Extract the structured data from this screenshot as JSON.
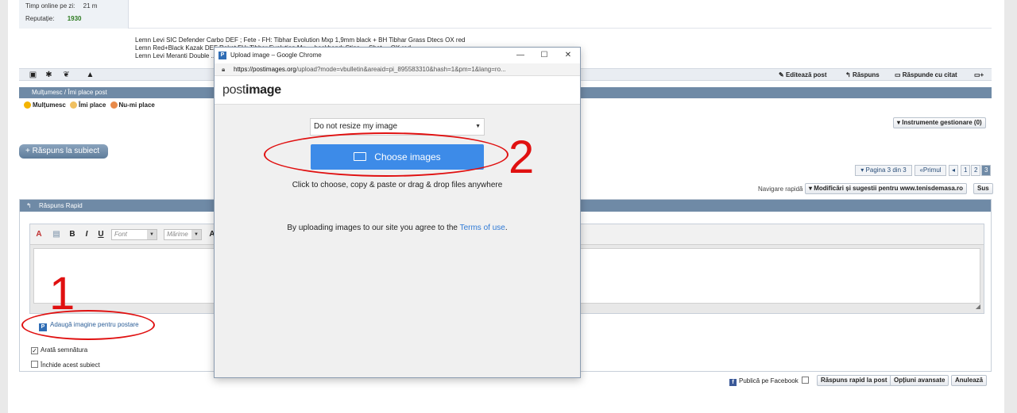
{
  "userinfo": {
    "online_label": "Timp online pe zi:",
    "online_value": "21 m",
    "rep_label": "Reputație:",
    "rep_value": "1930"
  },
  "signature": {
    "line1": "Lemn Levi SIC Defender Carbo DEF ; Fete - FH: Tibhar Evolution Mxp 1,9mm black + BH Tibhar Grass Dtecs OX red",
    "line2": "Lemn Red+Black Kazak DEF Raket FH: Tibhar Evolution Mx ... backhand: Stiga ... Shot ... OX red",
    "line3": "Lemn Levi Meranti Double ..."
  },
  "post_actions": {
    "edit": "Editează post",
    "reply": "Răspuns",
    "reply_quote": "Răspunde cu citat"
  },
  "thanks": {
    "bar": "Mulțumesc / Îmi place post",
    "thanks": "Mulțumesc",
    "like": "Îmi place",
    "dislike": "Nu-mi place"
  },
  "admin_tools": "▾ Instrumente gestionare (0)",
  "reply_button": "+ Răspuns la subiect",
  "pagination": {
    "page_info": "▾ Pagina 3 din 3",
    "first": "«Primul",
    "prev": "◂",
    "pages": [
      "1",
      "2",
      "3"
    ]
  },
  "quicknav": {
    "label": "Navigare rapidă",
    "forum": "▾ Modificări și sugestii pentru www.tenisdemasa.ro",
    "up": "Sus"
  },
  "quick_reply": {
    "title": "Răspuns Rapid",
    "font_placeholder": "Font",
    "size_placeholder": "Mărime",
    "add_image": "Adaugă imagine pentru postare",
    "show_signature": "Arată semnătura",
    "close_topic": "Închide acest subiect"
  },
  "footer": {
    "facebook": "Publică pe Facebook",
    "quick_post": "Răspuns rapid la post",
    "advanced": "Opțiuni avansate",
    "cancel": "Anulează"
  },
  "annotations": {
    "one": "1",
    "two": "2"
  },
  "popup": {
    "title": "Upload image – Google Chrome",
    "url_host": "https://postimages.org",
    "url_path": "/upload?mode=vbulletin&areaid=pi_895583310&hash=1&pm=1&lang=ro...",
    "logo_a": "post",
    "logo_b": "image",
    "resize": "Do not resize my image",
    "choose": "Choose images",
    "hint": "Click to choose, copy & paste or drag & drop files anywhere",
    "terms_pre": "By uploading images to our site you agree to the ",
    "terms_link": "Terms of use",
    "terms_post": "."
  },
  "colors": {
    "accent_blue": "#3d8be8",
    "annotation_red": "#e01010",
    "forum_bar": "#6f8aa6"
  }
}
